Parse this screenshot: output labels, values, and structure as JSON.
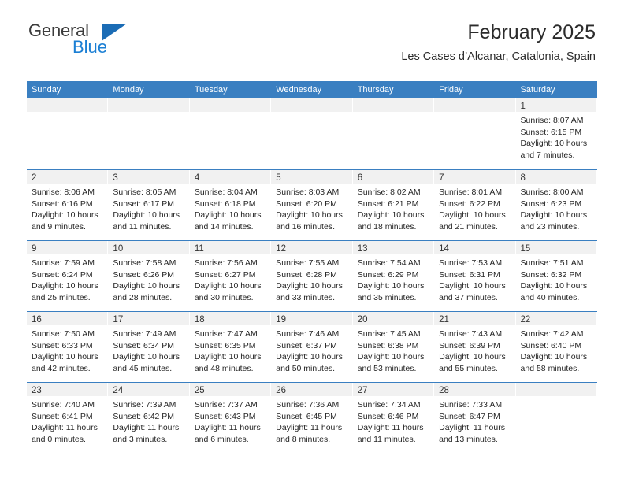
{
  "brand": {
    "name_top": "General",
    "name_bottom": "Blue",
    "triangle_color": "#1b6cb5",
    "blue_color": "#1b7fd4",
    "gray_color": "#3b3b3b"
  },
  "header": {
    "title": "February 2025",
    "subtitle": "Les Cases d’Alcanar, Catalonia, Spain"
  },
  "theme": {
    "header_blue": "#3a7fc1",
    "daynum_band": "#f1f1f1",
    "text": "#262626"
  },
  "calendar": {
    "weekday_headers": [
      "Sunday",
      "Monday",
      "Tuesday",
      "Wednesday",
      "Thursday",
      "Friday",
      "Saturday"
    ],
    "weeks": [
      [
        {
          "day": "",
          "sunrise": "",
          "sunset": "",
          "daylight": "",
          "daylight2": ""
        },
        {
          "day": "",
          "sunrise": "",
          "sunset": "",
          "daylight": "",
          "daylight2": ""
        },
        {
          "day": "",
          "sunrise": "",
          "sunset": "",
          "daylight": "",
          "daylight2": ""
        },
        {
          "day": "",
          "sunrise": "",
          "sunset": "",
          "daylight": "",
          "daylight2": ""
        },
        {
          "day": "",
          "sunrise": "",
          "sunset": "",
          "daylight": "",
          "daylight2": ""
        },
        {
          "day": "",
          "sunrise": "",
          "sunset": "",
          "daylight": "",
          "daylight2": ""
        },
        {
          "day": "1",
          "sunrise": "Sunrise: 8:07 AM",
          "sunset": "Sunset: 6:15 PM",
          "daylight": "Daylight: 10 hours",
          "daylight2": "and 7 minutes."
        }
      ],
      [
        {
          "day": "2",
          "sunrise": "Sunrise: 8:06 AM",
          "sunset": "Sunset: 6:16 PM",
          "daylight": "Daylight: 10 hours",
          "daylight2": "and 9 minutes."
        },
        {
          "day": "3",
          "sunrise": "Sunrise: 8:05 AM",
          "sunset": "Sunset: 6:17 PM",
          "daylight": "Daylight: 10 hours",
          "daylight2": "and 11 minutes."
        },
        {
          "day": "4",
          "sunrise": "Sunrise: 8:04 AM",
          "sunset": "Sunset: 6:18 PM",
          "daylight": "Daylight: 10 hours",
          "daylight2": "and 14 minutes."
        },
        {
          "day": "5",
          "sunrise": "Sunrise: 8:03 AM",
          "sunset": "Sunset: 6:20 PM",
          "daylight": "Daylight: 10 hours",
          "daylight2": "and 16 minutes."
        },
        {
          "day": "6",
          "sunrise": "Sunrise: 8:02 AM",
          "sunset": "Sunset: 6:21 PM",
          "daylight": "Daylight: 10 hours",
          "daylight2": "and 18 minutes."
        },
        {
          "day": "7",
          "sunrise": "Sunrise: 8:01 AM",
          "sunset": "Sunset: 6:22 PM",
          "daylight": "Daylight: 10 hours",
          "daylight2": "and 21 minutes."
        },
        {
          "day": "8",
          "sunrise": "Sunrise: 8:00 AM",
          "sunset": "Sunset: 6:23 PM",
          "daylight": "Daylight: 10 hours",
          "daylight2": "and 23 minutes."
        }
      ],
      [
        {
          "day": "9",
          "sunrise": "Sunrise: 7:59 AM",
          "sunset": "Sunset: 6:24 PM",
          "daylight": "Daylight: 10 hours",
          "daylight2": "and 25 minutes."
        },
        {
          "day": "10",
          "sunrise": "Sunrise: 7:58 AM",
          "sunset": "Sunset: 6:26 PM",
          "daylight": "Daylight: 10 hours",
          "daylight2": "and 28 minutes."
        },
        {
          "day": "11",
          "sunrise": "Sunrise: 7:56 AM",
          "sunset": "Sunset: 6:27 PM",
          "daylight": "Daylight: 10 hours",
          "daylight2": "and 30 minutes."
        },
        {
          "day": "12",
          "sunrise": "Sunrise: 7:55 AM",
          "sunset": "Sunset: 6:28 PM",
          "daylight": "Daylight: 10 hours",
          "daylight2": "and 33 minutes."
        },
        {
          "day": "13",
          "sunrise": "Sunrise: 7:54 AM",
          "sunset": "Sunset: 6:29 PM",
          "daylight": "Daylight: 10 hours",
          "daylight2": "and 35 minutes."
        },
        {
          "day": "14",
          "sunrise": "Sunrise: 7:53 AM",
          "sunset": "Sunset: 6:31 PM",
          "daylight": "Daylight: 10 hours",
          "daylight2": "and 37 minutes."
        },
        {
          "day": "15",
          "sunrise": "Sunrise: 7:51 AM",
          "sunset": "Sunset: 6:32 PM",
          "daylight": "Daylight: 10 hours",
          "daylight2": "and 40 minutes."
        }
      ],
      [
        {
          "day": "16",
          "sunrise": "Sunrise: 7:50 AM",
          "sunset": "Sunset: 6:33 PM",
          "daylight": "Daylight: 10 hours",
          "daylight2": "and 42 minutes."
        },
        {
          "day": "17",
          "sunrise": "Sunrise: 7:49 AM",
          "sunset": "Sunset: 6:34 PM",
          "daylight": "Daylight: 10 hours",
          "daylight2": "and 45 minutes."
        },
        {
          "day": "18",
          "sunrise": "Sunrise: 7:47 AM",
          "sunset": "Sunset: 6:35 PM",
          "daylight": "Daylight: 10 hours",
          "daylight2": "and 48 minutes."
        },
        {
          "day": "19",
          "sunrise": "Sunrise: 7:46 AM",
          "sunset": "Sunset: 6:37 PM",
          "daylight": "Daylight: 10 hours",
          "daylight2": "and 50 minutes."
        },
        {
          "day": "20",
          "sunrise": "Sunrise: 7:45 AM",
          "sunset": "Sunset: 6:38 PM",
          "daylight": "Daylight: 10 hours",
          "daylight2": "and 53 minutes."
        },
        {
          "day": "21",
          "sunrise": "Sunrise: 7:43 AM",
          "sunset": "Sunset: 6:39 PM",
          "daylight": "Daylight: 10 hours",
          "daylight2": "and 55 minutes."
        },
        {
          "day": "22",
          "sunrise": "Sunrise: 7:42 AM",
          "sunset": "Sunset: 6:40 PM",
          "daylight": "Daylight: 10 hours",
          "daylight2": "and 58 minutes."
        }
      ],
      [
        {
          "day": "23",
          "sunrise": "Sunrise: 7:40 AM",
          "sunset": "Sunset: 6:41 PM",
          "daylight": "Daylight: 11 hours",
          "daylight2": "and 0 minutes."
        },
        {
          "day": "24",
          "sunrise": "Sunrise: 7:39 AM",
          "sunset": "Sunset: 6:42 PM",
          "daylight": "Daylight: 11 hours",
          "daylight2": "and 3 minutes."
        },
        {
          "day": "25",
          "sunrise": "Sunrise: 7:37 AM",
          "sunset": "Sunset: 6:43 PM",
          "daylight": "Daylight: 11 hours",
          "daylight2": "and 6 minutes."
        },
        {
          "day": "26",
          "sunrise": "Sunrise: 7:36 AM",
          "sunset": "Sunset: 6:45 PM",
          "daylight": "Daylight: 11 hours",
          "daylight2": "and 8 minutes."
        },
        {
          "day": "27",
          "sunrise": "Sunrise: 7:34 AM",
          "sunset": "Sunset: 6:46 PM",
          "daylight": "Daylight: 11 hours",
          "daylight2": "and 11 minutes."
        },
        {
          "day": "28",
          "sunrise": "Sunrise: 7:33 AM",
          "sunset": "Sunset: 6:47 PM",
          "daylight": "Daylight: 11 hours",
          "daylight2": "and 13 minutes."
        },
        {
          "day": "",
          "sunrise": "",
          "sunset": "",
          "daylight": "",
          "daylight2": ""
        }
      ]
    ]
  }
}
